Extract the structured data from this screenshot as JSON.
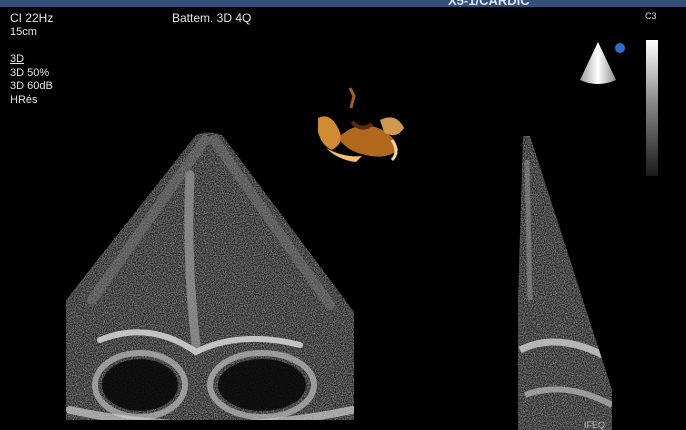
{
  "header": {
    "top_right_text": "X5-1/CARDIC"
  },
  "top_left": {
    "line1": "CI 22Hz",
    "line2": "15cm",
    "mode_title": "3D",
    "mode_line1": "3D 50%",
    "mode_line2": "3D 60dB",
    "mode_line3": "HRés"
  },
  "view_title": "Battem. 3D 4Q",
  "probe_label": "C3",
  "bottom_right_label": "IFEQ",
  "colors": {
    "header_bar": "#33507a",
    "probe_dot": "#2f6fd0",
    "render_3d": "#e89a3a"
  }
}
